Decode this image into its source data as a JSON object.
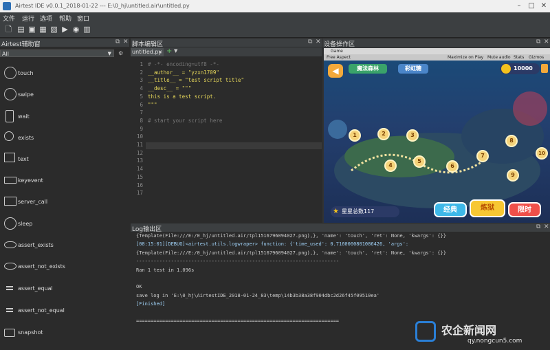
{
  "window": {
    "title": "Airtest IDE v0.0.1_2018-01-22 --- E:\\0_hj\\untitled.air\\untitled.py"
  },
  "menu": [
    "文件",
    "运行",
    "选项",
    "帮助",
    "窗口"
  ],
  "left_panel": {
    "title": "Airtest辅助窗",
    "filter_value": "All",
    "items": [
      {
        "label": "touch",
        "icon": "hand-touch-icon"
      },
      {
        "label": "swipe",
        "icon": "hand-swipe-icon"
      },
      {
        "label": "wait",
        "icon": "phone-clock-icon"
      },
      {
        "label": "exists",
        "icon": "magnifier-icon"
      },
      {
        "label": "text",
        "icon": "text-box-icon"
      },
      {
        "label": "keyevent",
        "icon": "keyboard-icon"
      },
      {
        "label": "server_call",
        "icon": "server-icon"
      },
      {
        "label": "sleep",
        "icon": "clock-icon"
      },
      {
        "label": "assert_exists",
        "icon": "eye-icon"
      },
      {
        "label": "assert_not_exists",
        "icon": "eye-off-icon"
      },
      {
        "label": "assert_equal",
        "icon": "equal-icon"
      },
      {
        "label": "assert_not_equal",
        "icon": "not-equal-icon"
      },
      {
        "label": "snapshot",
        "icon": "camera-icon"
      }
    ]
  },
  "editor": {
    "title": "脚本编辑区",
    "tab": "untitled.py",
    "lines": [
      {
        "n": "1",
        "text": "# -*- encoding=utf8 -*-",
        "color": "#777777"
      },
      {
        "n": "2",
        "text": "__author__ = \"yzxn1709\"",
        "color": "#e6d75a"
      },
      {
        "n": "3",
        "text": "__title__ = \"test script title\"",
        "color": "#e6d75a"
      },
      {
        "n": "4",
        "text": "__desc__ = \"\"\"",
        "color": "#e6d75a"
      },
      {
        "n": "5",
        "text": "this is a test script.",
        "color": "#e6d75a"
      },
      {
        "n": "6",
        "text": "\"\"\"",
        "color": "#e6d75a"
      },
      {
        "n": "7",
        "text": "",
        "color": "#cccccc"
      },
      {
        "n": "8",
        "text": "# start your script here",
        "color": "#777777"
      },
      {
        "n": "9",
        "text": "",
        "color": "#cccccc"
      },
      {
        "n": "10",
        "text": "",
        "color": "#cccccc"
      },
      {
        "n": "11",
        "text": "",
        "color": "#cccccc"
      },
      {
        "n": "12",
        "text": "",
        "color": "#cccccc"
      },
      {
        "n": "13",
        "text": "",
        "color": "#cccccc"
      },
      {
        "n": "14",
        "text": "",
        "color": "#cccccc"
      },
      {
        "n": "15",
        "text": "",
        "color": "#cccccc"
      },
      {
        "n": "16",
        "text": "",
        "color": "#cccccc"
      },
      {
        "n": "17",
        "text": "",
        "color": "#cccccc"
      }
    ]
  },
  "device": {
    "title": "设备操作区",
    "game_tab": "Game",
    "aspect": "Free Aspect",
    "toolbar_items": [
      "Maximize on Play",
      "Mute audio",
      "Stats",
      "Gizmos"
    ],
    "banner_left": "魔法森林",
    "banner_right": "彩虹糖",
    "coins": "10000",
    "stars_label": "星星总数117",
    "buttons": [
      "经典",
      "炼狱",
      "限时"
    ],
    "nodes": [
      "1",
      "2",
      "3",
      "4",
      "5",
      "6",
      "7",
      "8",
      "9",
      "10"
    ]
  },
  "log": {
    "title": "Log输出区",
    "lines": [
      {
        "text": "{Template(File:///E:/0_hj/untitled.air/tpl1516796094027.png),}, 'name': 'touch', 'ret': None, 'kwargs': {}}",
        "color": "#cccccc"
      },
      {
        "text": "[08:15:01][DEBUG]<airtest.utils.logwraper> function: {'time_used': 0.7160000801086426, 'args':",
        "color": "#9fd0f5"
      },
      {
        "text": "{Template(File:///E:/0_hj/untitled.air/tpl1516796094027.png),}, 'name': 'touch', 'ret': None, 'kwargs': {}}",
        "color": "#cccccc"
      },
      {
        "text": "----------------------------------------------------------------------",
        "color": "#cccccc"
      },
      {
        "text": "Ran 1 test in 1.096s",
        "color": "#cccccc"
      },
      {
        "text": "",
        "color": "#cccccc"
      },
      {
        "text": "OK",
        "color": "#cccccc"
      },
      {
        "text": "save log in 'E:\\0_hj\\AirtestIDE_2018-01-24_83\\temp\\14b3b38a38f904dbc2d26f45f09510ea'",
        "color": "#cccccc"
      },
      {
        "text": "[Finished]",
        "color": "#9fd0f5"
      },
      {
        "text": "",
        "color": "#cccccc"
      },
      {
        "text": "======================================================================",
        "color": "#cccccc"
      }
    ]
  },
  "watermark": {
    "brand": "农企新闻网",
    "url": "qy.nongcun5.com"
  }
}
